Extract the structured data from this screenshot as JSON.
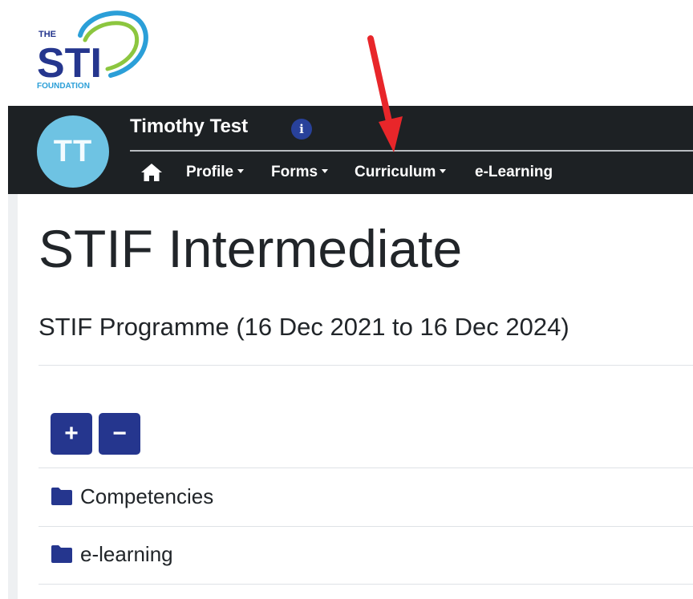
{
  "logo": {
    "the": "THE",
    "sti": "STI",
    "foundation": "FOUNDATION"
  },
  "navbar": {
    "avatar_initials": "TT",
    "user_name": "Timothy Test",
    "info_glyph": "i",
    "items": [
      {
        "label": "Profile",
        "dropdown": true
      },
      {
        "label": "Forms",
        "dropdown": true
      },
      {
        "label": "Curriculum",
        "dropdown": true
      },
      {
        "label": "e-Learning",
        "dropdown": false
      }
    ]
  },
  "page": {
    "title": "STIF Intermediate",
    "subtitle": "STIF Programme (16 Dec 2021 to 16 Dec 2024)"
  },
  "toolbar": {
    "expand_label": "+",
    "collapse_label": "−"
  },
  "tree": {
    "items": [
      {
        "label": "Competencies",
        "icon": "folder-icon"
      },
      {
        "label": "e-learning",
        "icon": "folder-icon"
      }
    ]
  },
  "colors": {
    "navbar_bg": "#1d2124",
    "accent_blue": "#25368e",
    "avatar_bg": "#6ec3e3",
    "annotation_arrow": "#e8262a"
  }
}
